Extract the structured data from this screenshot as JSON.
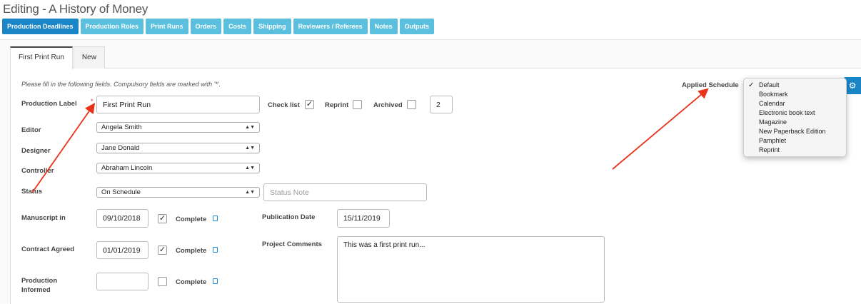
{
  "page": {
    "title": "Editing - A History of Money"
  },
  "nav": {
    "items": [
      {
        "label": "Production Deadlines",
        "active": true
      },
      {
        "label": "Production Roles"
      },
      {
        "label": "Print Runs"
      },
      {
        "label": "Orders"
      },
      {
        "label": "Costs"
      },
      {
        "label": "Shipping"
      },
      {
        "label": "Reviewers / Referees"
      },
      {
        "label": "Notes"
      },
      {
        "label": "Outputs"
      }
    ]
  },
  "tabs": [
    {
      "label": "First Print Run",
      "active": true
    },
    {
      "label": "New"
    }
  ],
  "form": {
    "hint": "Please fill in the following fields. Compulsory fields are marked with '*'.",
    "required_marker": "*",
    "production_label": {
      "label": "Production Label",
      "value": "First Print Run"
    },
    "check_list": {
      "label": "Check list",
      "checked": true,
      "mark": "✓"
    },
    "reprint": {
      "label": "Reprint",
      "checked": false
    },
    "archived": {
      "label": "Archived",
      "checked": false
    },
    "count_value": "2",
    "editor": {
      "label": "Editor",
      "value": "Angela Smith"
    },
    "designer": {
      "label": "Designer",
      "value": "Jane Donald"
    },
    "controller": {
      "label": "Controller",
      "value": "Abraham Lincoln"
    },
    "status": {
      "label": "Status",
      "value": "On Schedule",
      "note_placeholder": "Status Note"
    },
    "manuscript_in": {
      "label": "Manuscript in",
      "date": "09/10/2018",
      "complete_label": "Complete",
      "complete": true
    },
    "contract_agreed": {
      "label": "Contract Agreed",
      "date": "01/01/2019",
      "complete_label": "Complete",
      "complete": true
    },
    "production_informed": {
      "label_line1": "Production",
      "label_line2": "Informed",
      "date": "",
      "complete_label": "Complete",
      "complete": false
    },
    "publication_date": {
      "label": "Publication Date",
      "value": "15/11/2019"
    },
    "project_comments": {
      "label": "Project Comments",
      "value": "This was a first print run..."
    }
  },
  "schedule": {
    "label": "Applied Schedule",
    "selected_mark": "✓",
    "options": [
      "Default",
      "Bookmark",
      "Calendar",
      "Electronic book text",
      "Magazine",
      "New Paperback Edition",
      "Pamphlet",
      "Reprint"
    ],
    "selected": "Default"
  },
  "icons": {
    "gear": "gears-icon",
    "note": "note-icon",
    "select_arrows": "▲▼"
  },
  "colors": {
    "nav": "#5bc0de",
    "nav_active": "#1a86c8",
    "annotation_arrow": "#e8321c"
  }
}
